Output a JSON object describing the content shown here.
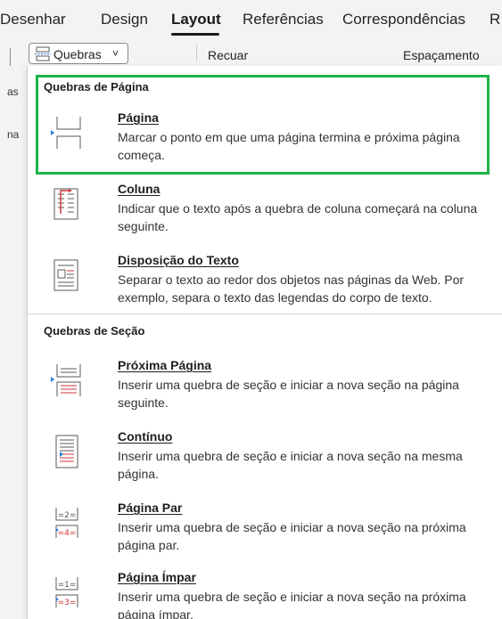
{
  "ribbon": {
    "tabs": [
      "Desenhar",
      "Design",
      "Layout",
      "Referências",
      "Correspondências",
      "R"
    ],
    "active_tab": "Layout",
    "quebras_label": "Quebras",
    "recuar_label": "Recuar",
    "espacamento_label": "Espaçamento"
  },
  "left_strip": {
    "fragment_1": "as",
    "fragment_2": "na"
  },
  "menu": {
    "page_breaks_header": "Quebras de Página",
    "section_breaks_header": "Quebras de Seção",
    "items": [
      {
        "title": "Página",
        "desc": "Marcar o ponto em que uma página termina e próxima página começa.",
        "icon": "page-break-icon"
      },
      {
        "title": "Coluna",
        "desc": "Indicar que o texto após a quebra de coluna começará na coluna seguinte.",
        "icon": "column-break-icon"
      },
      {
        "title": "Disposição do Texto",
        "desc": "Separar o texto ao redor dos objetos nas páginas da Web. Por exemplo, separa o texto das legendas do corpo de texto.",
        "icon": "text-wrapping-icon"
      },
      {
        "title": "Próxima Página",
        "desc": "Inserir uma quebra de seção e iniciar a nova seção na página seguinte.",
        "icon": "next-page-icon"
      },
      {
        "title": "Contínuo",
        "desc": "Inserir uma quebra de seção e iniciar a nova seção na mesma página.",
        "icon": "continuous-icon"
      },
      {
        "title": "Página Par",
        "desc": "Inserir uma quebra de seção e iniciar a nova seção na próxima página par.",
        "icon": "even-page-icon"
      },
      {
        "title": "Página Ímpar",
        "desc": "Inserir uma quebra de seção e iniciar a nova seção na próxima página ímpar.",
        "icon": "odd-page-icon"
      }
    ]
  },
  "colors": {
    "highlight": "#1db34a",
    "accent_red": "#d13438",
    "accent_blue": "#2b7cd3"
  }
}
